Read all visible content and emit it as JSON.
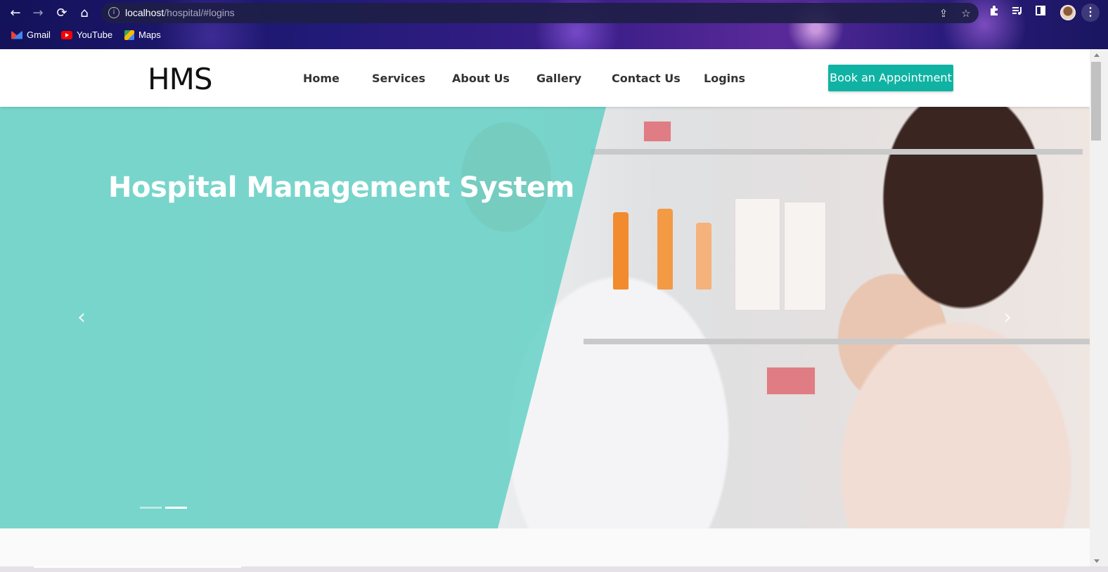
{
  "browser": {
    "url_host": "localhost",
    "url_path": "/hospital/#logins",
    "nav": {
      "back": "←",
      "forward": "→",
      "reload": "⟳",
      "home": "⌂"
    },
    "omnibox_icons": {
      "info": "i",
      "share": "⇪",
      "star": "☆"
    },
    "toolbar_icons": [
      "puzzle-icon",
      "media-icon",
      "sidebar-icon"
    ],
    "bookmarks": [
      {
        "label": "Gmail",
        "icon": "gmail-icon"
      },
      {
        "label": "YouTube",
        "icon": "youtube-icon"
      },
      {
        "label": "Maps",
        "icon": "maps-icon"
      }
    ],
    "menu": "⋮"
  },
  "site": {
    "logo": "HMS",
    "menu": [
      {
        "label": "Home"
      },
      {
        "label": "Services"
      },
      {
        "label": "About Us"
      },
      {
        "label": "Gallery"
      },
      {
        "label": "Contact Us"
      },
      {
        "label": "Logins"
      }
    ],
    "cta": "Book an Appointment",
    "accent_color": "#10b3a3"
  },
  "hero": {
    "title": "Hospital Management System",
    "prev": "‹",
    "next": "›",
    "slide_count": 2,
    "active_slide": 2,
    "overlay_color": "#58cec2"
  }
}
